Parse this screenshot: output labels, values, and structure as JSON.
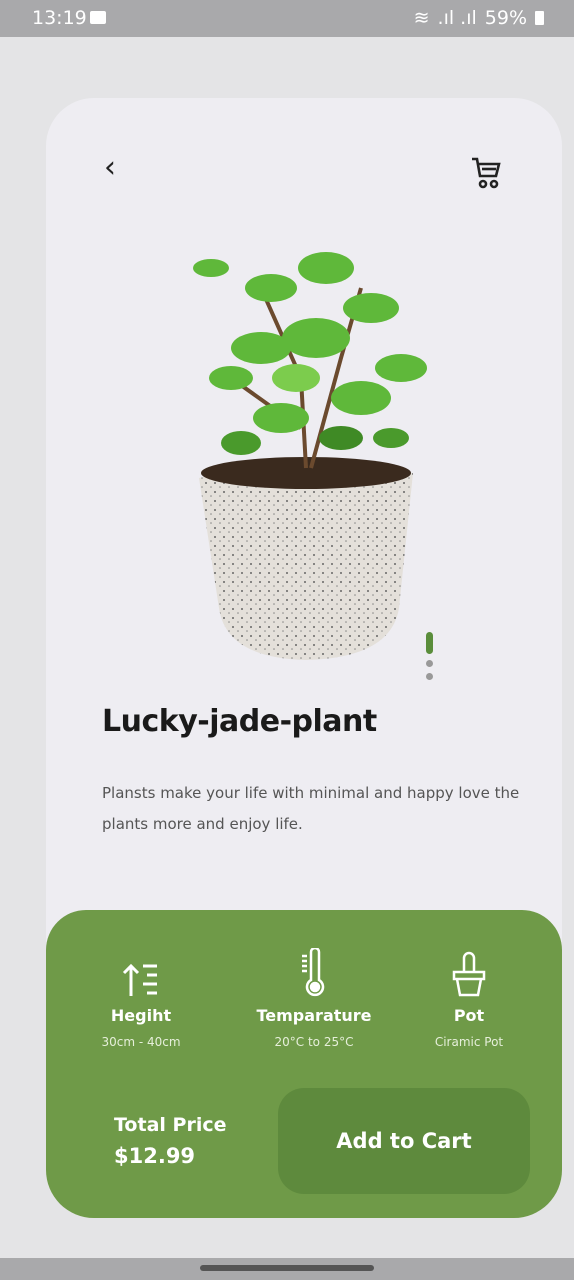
{
  "status": {
    "time": "13:19",
    "battery": "59%"
  },
  "product": {
    "name": "Lucky-jade-plant",
    "description": "Plansts make your life with minimal and happy love the plants more and enjoy life.",
    "image_pages": 3,
    "active_page": 0
  },
  "specs": [
    {
      "label": "Hegiht",
      "value": "30cm - 40cm",
      "icon": "height-icon"
    },
    {
      "label": "Temparature",
      "value": "20°C to 25°C",
      "icon": "thermometer-icon"
    },
    {
      "label": "Pot",
      "value": "Ciramic Pot",
      "icon": "pot-icon"
    }
  ],
  "price": {
    "label": "Total Price",
    "value": "$12.99"
  },
  "actions": {
    "add_to_cart": "Add to Cart"
  },
  "colors": {
    "accent": "#6f9a48",
    "button": "#5e8a3d"
  }
}
